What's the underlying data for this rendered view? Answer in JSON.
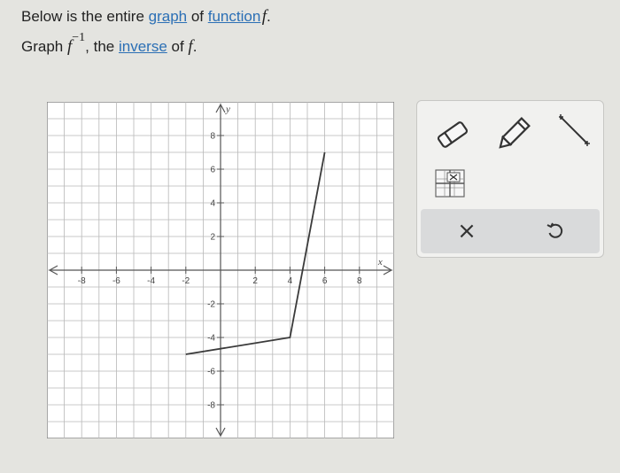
{
  "prompt": {
    "line1_prefix": "Below is the entire ",
    "link_graph": "graph",
    "line1_middle": " of ",
    "link_function": "function",
    "function_name": "f",
    "line1_end": ".",
    "line2_prefix": "Graph ",
    "inverse_symbol": "f",
    "inverse_exponent": "−1",
    "line2_middle": ", the ",
    "link_inverse": "inverse",
    "line2_of": " of ",
    "line2_function": "f",
    "line2_end": "."
  },
  "chart_data": {
    "type": "line",
    "xlabel": "x",
    "ylabel": "y",
    "xlim": [
      -10,
      10
    ],
    "ylim": [
      -10,
      10
    ],
    "grid": true,
    "x_tick_labels": [
      "-8",
      "-6",
      "-4",
      "-2",
      "2",
      "4",
      "6",
      "8"
    ],
    "y_tick_labels": [
      "8",
      "6",
      "4",
      "2",
      "-2",
      "-4",
      "-6",
      "-8"
    ],
    "x_ticks": [
      -8,
      -6,
      -4,
      -2,
      2,
      4,
      6,
      8
    ],
    "y_ticks": [
      8,
      6,
      4,
      2,
      -2,
      -4,
      -6,
      -8
    ],
    "series": [
      {
        "points": [
          [
            -2,
            -5
          ],
          [
            4,
            -4
          ],
          [
            6,
            7
          ]
        ],
        "color": "#3a3a3a"
      }
    ]
  },
  "tools": {
    "eraser": "eraser-icon",
    "pencil": "pencil-icon",
    "line": "line-segment-icon",
    "no_solution": "no-solution-icon",
    "clear_symbol": "×",
    "undo": "undo-icon"
  },
  "colors": {
    "background": "#e4e4e0",
    "link": "#2b6fb5",
    "grid": "#b8b8b8",
    "axis": "#555555",
    "panel": "#f1f1ef",
    "action_bar": "#d9dadb"
  }
}
